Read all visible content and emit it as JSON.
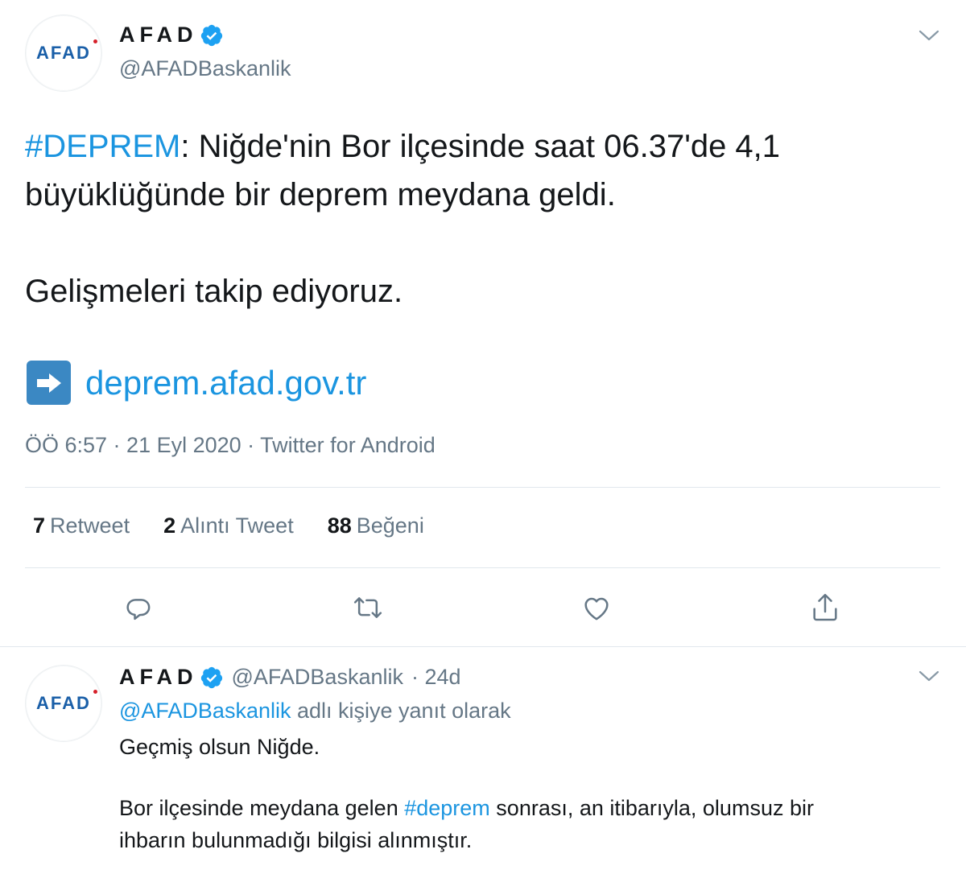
{
  "main_tweet": {
    "logo_text": "AFAD",
    "display_name": "AFAD",
    "handle": "@AFADBaskanlik",
    "text": {
      "hashtag": "#DEPREM",
      "line1_rest": ": Niğde'nin Bor ilçesinde saat 06.37'de 4,1",
      "line2": "büyüklüğünde bir deprem meydana geldi.",
      "line3": "Gelişmeleri takip ediyoruz."
    },
    "link": "deprem.afad.gov.tr",
    "meta": "ÖÖ 6:57 · 21 Eyl 2020 · Twitter for Android",
    "stats": [
      {
        "count": "7",
        "label": "Retweet"
      },
      {
        "count": "2",
        "label": "Alıntı Tweet"
      },
      {
        "count": "88",
        "label": "Beğeni"
      }
    ],
    "icons": {
      "reply": "comment-icon",
      "retweet": "retweet-icon",
      "like": "heart-icon",
      "share": "share-icon",
      "menu": "chevron-down-icon",
      "verified": "verified-badge-icon",
      "link_arrow": "right-arrow-icon"
    }
  },
  "reply_tweet": {
    "logo_text": "AFAD",
    "display_name": "AFAD",
    "handle": "@AFADBaskanlik",
    "time": "· 24d",
    "reply_mention": "@AFADBaskanlik",
    "reply_suffix": " adlı kişiye yanıt olarak",
    "para1": "Geçmiş olsun Niğde.",
    "para2_before": "Bor ilçesinde meydana gelen ",
    "para2_hashtag": "#deprem",
    "para2_after": " sonrası, an itibarıyla, olumsuz bir",
    "para2_line2": "ihbarın bulunmadığı bilgisi alınmıştır."
  },
  "colors": {
    "link_blue": "#1b95e0",
    "secondary_gray": "#657786",
    "verified_blue": "#1da1f2",
    "logo_blue": "#1a5fa8",
    "logo_red": "#d6202a",
    "divider": "#e1e8ed"
  }
}
